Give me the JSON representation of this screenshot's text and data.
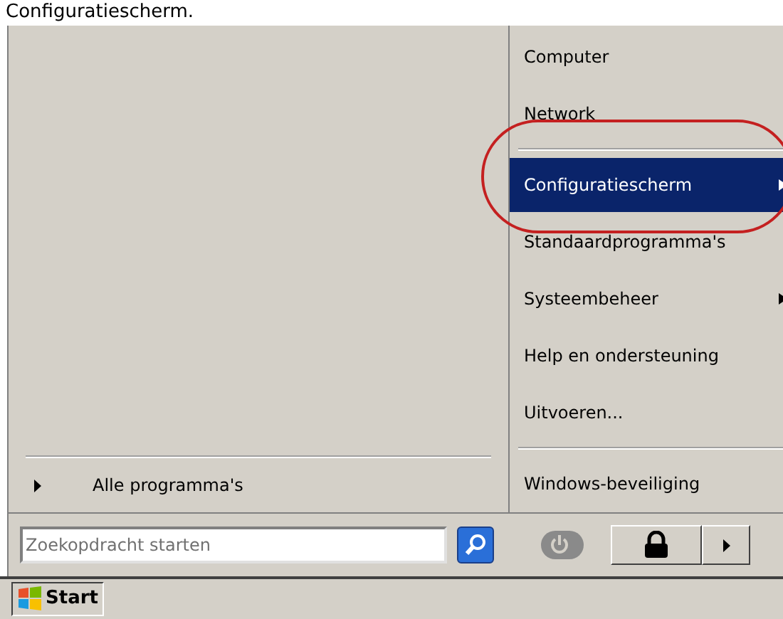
{
  "caption": "Configuratiescherm.",
  "left_pane": {
    "all_programs": "Alle programma's"
  },
  "right_pane": {
    "items": [
      {
        "kind": "item",
        "label": "Computer",
        "selected": false,
        "submenu": false,
        "highlighted": false
      },
      {
        "kind": "item",
        "label": "Network",
        "selected": false,
        "submenu": false,
        "highlighted": false
      },
      {
        "kind": "separator"
      },
      {
        "kind": "item",
        "label": "Configuratiescherm",
        "selected": true,
        "submenu": true,
        "highlighted": true
      },
      {
        "kind": "item",
        "label": "Standaardprogramma's",
        "selected": false,
        "submenu": false,
        "highlighted": false
      },
      {
        "kind": "item",
        "label": "Systeembeheer",
        "selected": false,
        "submenu": true,
        "highlighted": false
      },
      {
        "kind": "item",
        "label": "Help en ondersteuning",
        "selected": false,
        "submenu": false,
        "highlighted": false
      },
      {
        "kind": "item",
        "label": "Uitvoeren...",
        "selected": false,
        "submenu": false,
        "highlighted": false
      },
      {
        "kind": "separator"
      },
      {
        "kind": "item",
        "label": "Windows-beveiliging",
        "selected": false,
        "submenu": false,
        "highlighted": false
      }
    ]
  },
  "search": {
    "placeholder": "Zoekopdracht starten"
  },
  "taskbar": {
    "start": "Start"
  }
}
